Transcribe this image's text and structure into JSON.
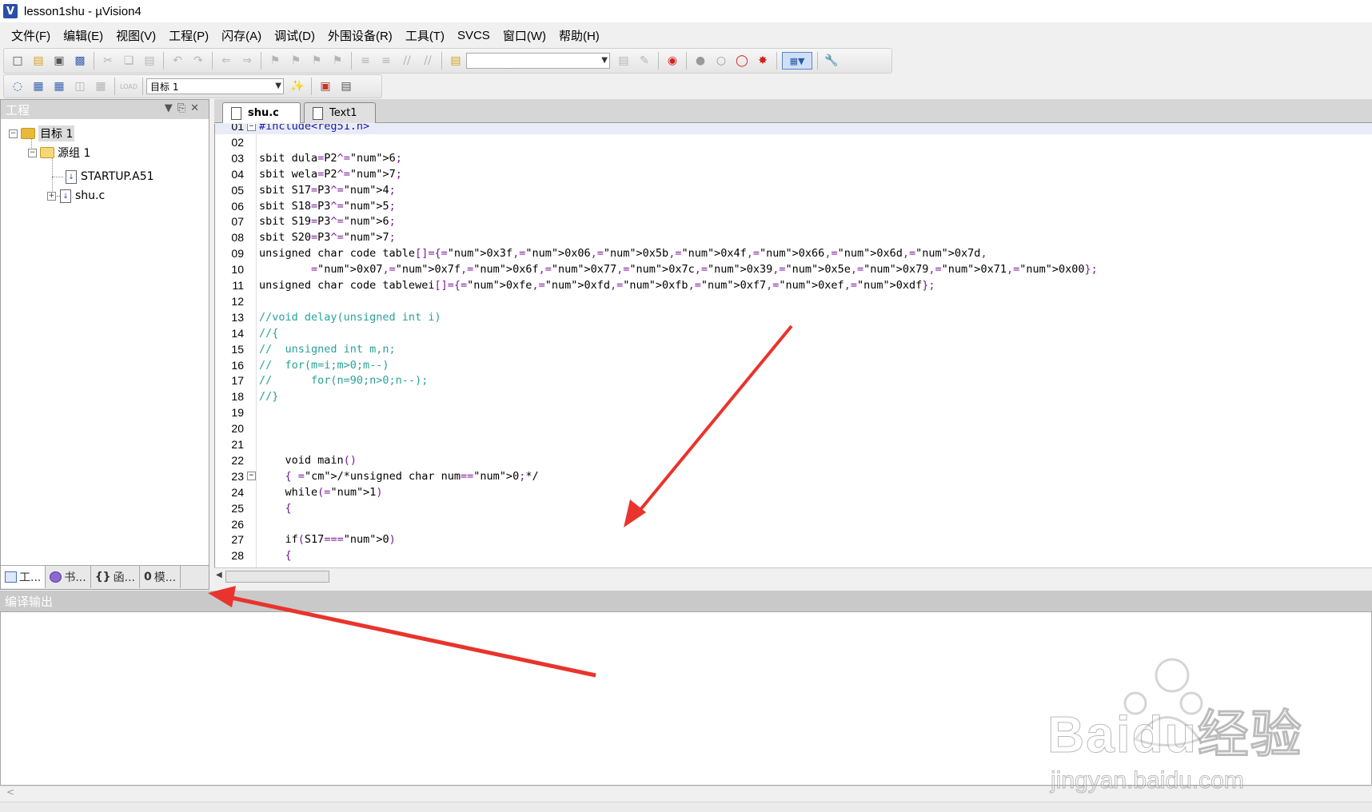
{
  "window": {
    "title": "lesson1shu  - µVision4",
    "logo": "V"
  },
  "menu": [
    "文件(F)",
    "编辑(E)",
    "视图(V)",
    "工程(P)",
    "闪存(A)",
    "调试(D)",
    "外围设备(R)",
    "工具(T)",
    "SVCS",
    "窗口(W)",
    "帮助(H)"
  ],
  "toolbar2": {
    "target_select": "目标 1"
  },
  "project_panel": {
    "title": "工程",
    "tree": {
      "target": "目标 1",
      "group": "源组 1",
      "files": [
        "STARTUP.A51",
        "shu.c"
      ]
    },
    "tabs": [
      "工...",
      "书...",
      "函...",
      "模..."
    ],
    "tab_icons": [
      "project-icon",
      "books-icon",
      "functions-icon",
      "templates-icon"
    ],
    "functions_tab_glyph": "{}",
    "templates_tab_glyph": "0"
  },
  "editor": {
    "tabs": [
      "shu.c",
      "Text1"
    ],
    "active_tab": "shu.c",
    "lines": [
      {
        "n": "01",
        "text": "#include<reg51.h>"
      },
      {
        "n": "02",
        "text": ""
      },
      {
        "n": "03",
        "text": "sbit dula=P2^6;"
      },
      {
        "n": "04",
        "text": "sbit wela=P2^7;"
      },
      {
        "n": "05",
        "text": "sbit S17=P3^4;"
      },
      {
        "n": "06",
        "text": "sbit S18=P3^5;"
      },
      {
        "n": "07",
        "text": "sbit S19=P3^6;"
      },
      {
        "n": "08",
        "text": "sbit S20=P3^7;"
      },
      {
        "n": "09",
        "text": "unsigned char code table[]={0x3f,0x06,0x5b,0x4f,0x66,0x6d,0x7d,"
      },
      {
        "n": "10",
        "text": "        0x07,0x7f,0x6f,0x77,0x7c,0x39,0x5e,0x79,0x71,0x00};"
      },
      {
        "n": "11",
        "text": "unsigned char code tablewei[]={0xfe,0xfd,0xfb,0xf7,0xef,0xdf};"
      },
      {
        "n": "12",
        "text": ""
      },
      {
        "n": "13",
        "text": "//void delay(unsigned int i)"
      },
      {
        "n": "14",
        "text": "//{"
      },
      {
        "n": "15",
        "text": "//  unsigned int m,n;"
      },
      {
        "n": "16",
        "text": "//  for(m=i;m>0;m--)"
      },
      {
        "n": "17",
        "text": "//      for(n=90;n>0;n--);"
      },
      {
        "n": "18",
        "text": "//}"
      },
      {
        "n": "19",
        "text": ""
      },
      {
        "n": "20",
        "text": ""
      },
      {
        "n": "21",
        "text": ""
      },
      {
        "n": "22",
        "text": "    void main()"
      },
      {
        "n": "23",
        "text": "    { /*unsigned char num=0;*/"
      },
      {
        "n": "24",
        "text": "    while(1)"
      },
      {
        "n": "25",
        "text": "    {"
      },
      {
        "n": "26",
        "text": ""
      },
      {
        "n": "27",
        "text": "    if(S17==0)"
      },
      {
        "n": "28",
        "text": "    {"
      }
    ]
  },
  "output_panel": {
    "title": "编译输出",
    "scroll_left": "<"
  },
  "colors": {
    "annotation_arrow": "#e8342c",
    "comment": "#2aa198",
    "number": "#7a1a9a",
    "current_line": "#e8ecf8"
  },
  "watermark": {
    "brand": "Baidu经验",
    "url": "jingyan.baidu.com"
  }
}
